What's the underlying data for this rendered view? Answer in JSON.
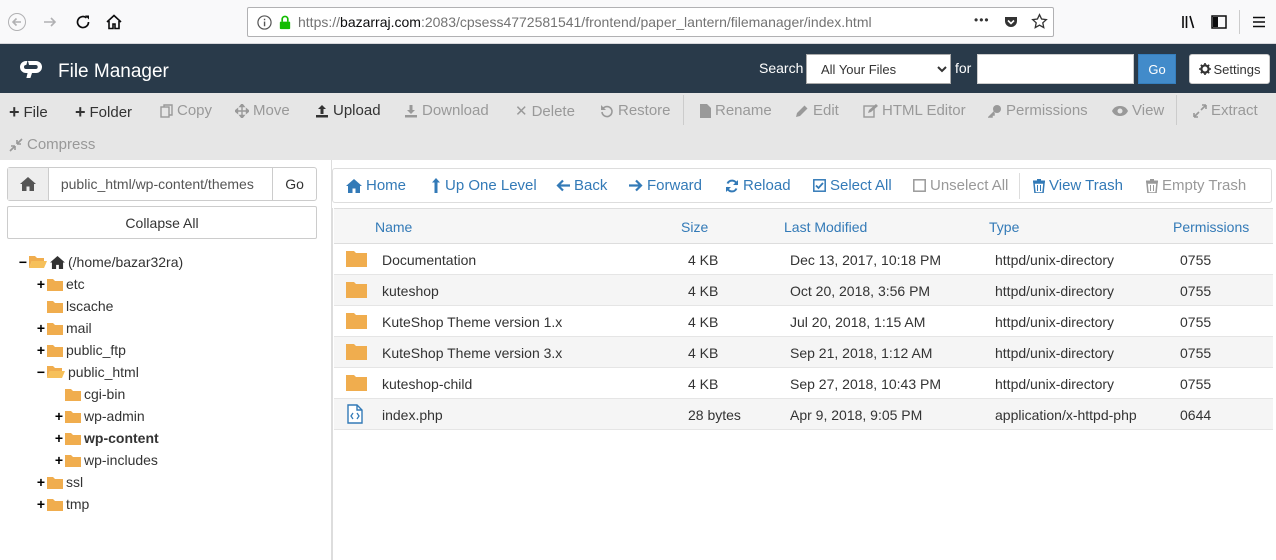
{
  "browser": {
    "url_prefix": "https://",
    "url_domain": "bazarraj.com",
    "url_rest": ":2083/cpsess4772581541/frontend/paper_lantern/filemanager/index.html",
    "more_label": "•••"
  },
  "header": {
    "title": "File Manager",
    "search_label": "Search",
    "search_scope": "All Your Files",
    "for_label": "for",
    "search_value": "",
    "go_label": "Go",
    "settings_label": "Settings"
  },
  "toolbar": {
    "items": [
      {
        "label": "File"
      },
      {
        "label": "Folder"
      },
      {
        "label": "Copy"
      },
      {
        "label": "Move"
      },
      {
        "label": "Upload"
      },
      {
        "label": "Download"
      },
      {
        "label": "Delete"
      },
      {
        "label": "Restore"
      },
      {
        "label": "Rename"
      },
      {
        "label": "Edit"
      },
      {
        "label": "HTML Editor"
      },
      {
        "label": "Permissions"
      },
      {
        "label": "View"
      },
      {
        "label": "Extract"
      },
      {
        "label": "Compress"
      }
    ]
  },
  "sidebar": {
    "path_value": "public_html/wp-content/themes",
    "go_label": "Go",
    "collapse_label": "Collapse All",
    "tree": [
      {
        "label": "(/home/bazar32ra)"
      },
      {
        "label": "etc"
      },
      {
        "label": "lscache"
      },
      {
        "label": "mail"
      },
      {
        "label": "public_ftp"
      },
      {
        "label": "public_html"
      },
      {
        "label": "cgi-bin"
      },
      {
        "label": "wp-admin"
      },
      {
        "label": "wp-content"
      },
      {
        "label": "wp-includes"
      },
      {
        "label": "ssl"
      },
      {
        "label": "tmp"
      }
    ]
  },
  "nav": {
    "home": "Home",
    "up": "Up One Level",
    "back": "Back",
    "forward": "Forward",
    "reload": "Reload",
    "select_all": "Select All",
    "unselect_all": "Unselect All",
    "view_trash": "View Trash",
    "empty_trash": "Empty Trash"
  },
  "table": {
    "columns": {
      "name": "Name",
      "size": "Size",
      "modified": "Last Modified",
      "type": "Type",
      "perms": "Permissions"
    },
    "rows": [
      {
        "name": "Documentation",
        "size": "4 KB",
        "modified": "Dec 13, 2017, 10:18 PM",
        "type": "httpd/unix-directory",
        "perms": "0755"
      },
      {
        "name": "kuteshop",
        "size": "4 KB",
        "modified": "Oct 20, 2018, 3:56 PM",
        "type": "httpd/unix-directory",
        "perms": "0755"
      },
      {
        "name": "KuteShop Theme version 1.x",
        "size": "4 KB",
        "modified": "Jul 20, 2018, 1:15 AM",
        "type": "httpd/unix-directory",
        "perms": "0755"
      },
      {
        "name": "KuteShop Theme version 3.x",
        "size": "4 KB",
        "modified": "Sep 21, 2018, 1:12 AM",
        "type": "httpd/unix-directory",
        "perms": "0755"
      },
      {
        "name": "kuteshop-child",
        "size": "4 KB",
        "modified": "Sep 27, 2018, 10:43 PM",
        "type": "httpd/unix-directory",
        "perms": "0755"
      },
      {
        "name": "index.php",
        "size": "28 bytes",
        "modified": "Apr 9, 2018, 9:05 PM",
        "type": "application/x-httpd-php",
        "perms": "0644"
      }
    ]
  },
  "colors": {
    "header_bg": "#293a4a",
    "link": "#337ab7",
    "folder": "#f0ad4e",
    "go_button": "#428bca"
  }
}
